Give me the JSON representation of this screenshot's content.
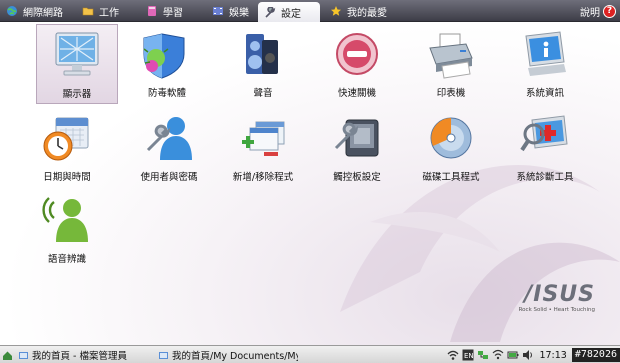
{
  "tabs": [
    {
      "label": "網際網路",
      "icon": "globe-icon"
    },
    {
      "label": "工作",
      "icon": "folder-icon"
    },
    {
      "label": "學習",
      "icon": "book-icon"
    },
    {
      "label": "娛樂",
      "icon": "film-icon"
    },
    {
      "label": "設定",
      "icon": "wrench-icon",
      "active": true
    },
    {
      "label": "我的最愛",
      "icon": "star-icon"
    }
  ],
  "help": {
    "label": "說明",
    "badge": "?"
  },
  "apps": [
    {
      "label": "顯示器",
      "icon": "monitor-icon",
      "selected": true
    },
    {
      "label": "防毒軟體",
      "icon": "antivirus-shield-icon"
    },
    {
      "label": "聲音",
      "icon": "speaker-icon"
    },
    {
      "label": "快速關機",
      "icon": "shutdown-icon"
    },
    {
      "label": "印表機",
      "icon": "printer-icon"
    },
    {
      "label": "系統資訊",
      "icon": "system-info-icon"
    },
    {
      "label": "日期與時間",
      "icon": "calendar-clock-icon"
    },
    {
      "label": "使用者與密碼",
      "icon": "user-icon"
    },
    {
      "label": "新增/移除程式",
      "icon": "add-remove-programs-icon"
    },
    {
      "label": "觸控板設定",
      "icon": "touchpad-icon"
    },
    {
      "label": "磁碟工具程式",
      "icon": "disk-utility-icon"
    },
    {
      "label": "系統診斷工具",
      "icon": "diagnostics-icon"
    },
    {
      "label": "語音辨識",
      "icon": "voice-recognition-icon"
    }
  ],
  "brand": {
    "name": "/ISUS",
    "tagline": "Rock Solid • Heart Touching"
  },
  "taskbar": {
    "tasks": [
      {
        "label": "我的首頁 - 檔案管理員"
      },
      {
        "label": "我的首頁/My Documents/My P"
      }
    ],
    "clock": "17:13",
    "tag": "#782026"
  },
  "colors": {
    "tabbar": "#4a4a55",
    "accent_red": "#d22222"
  }
}
